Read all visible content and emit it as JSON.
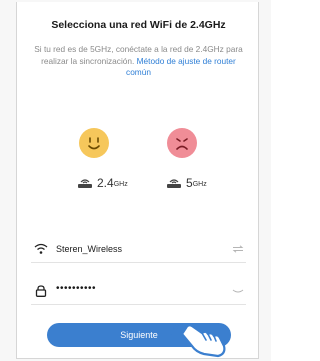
{
  "title": "Selecciona una red WiFi de 2.4GHz",
  "description": {
    "text": "Si tu red es de 5GHz, conéctate a la red de 2.4GHz para realizar la sincronización.",
    "link": "Método de ajuste de router común"
  },
  "bands": {
    "good": {
      "number": "2.4",
      "unit": "GHz"
    },
    "bad": {
      "number": "5",
      "unit": "GHz"
    }
  },
  "form": {
    "wifi_name": "Steren_Wireless",
    "password_mask": "••••••••••"
  },
  "button": {
    "label": "Siguiente"
  },
  "colors": {
    "accent": "#3b7fcf",
    "good_face": "#f6c75b",
    "bad_face": "#f08d97"
  }
}
